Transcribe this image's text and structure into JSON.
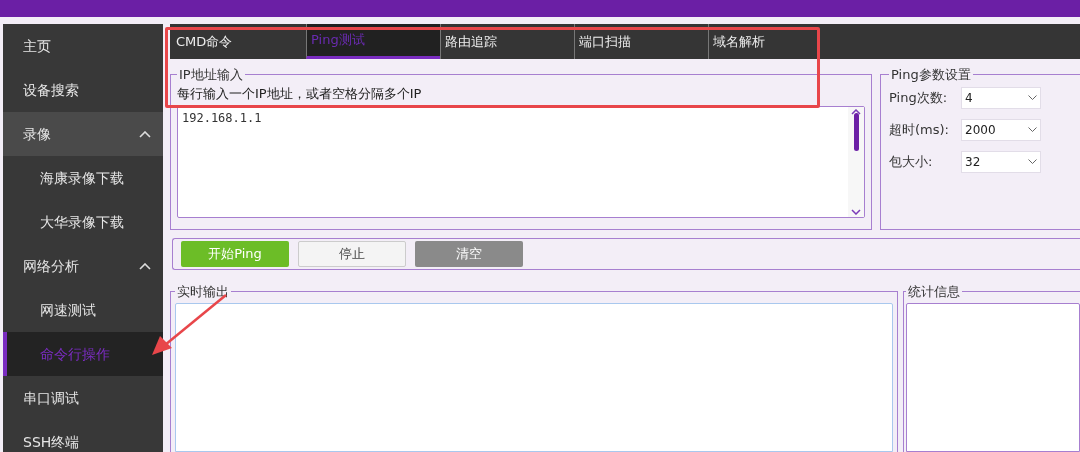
{
  "sidebar": {
    "items": [
      {
        "label": "主页",
        "selected": false,
        "hovered": false
      },
      {
        "label": "设备搜索",
        "selected": false,
        "hovered": false
      },
      {
        "label": "录像",
        "selected": false,
        "hovered": true,
        "expanded": true,
        "children": [
          {
            "label": "海康录像下载",
            "selected": false
          },
          {
            "label": "大华录像下载",
            "selected": false
          }
        ]
      },
      {
        "label": "网络分析",
        "selected": false,
        "hovered": false,
        "expanded": true,
        "children": [
          {
            "label": "网速测试",
            "selected": false
          },
          {
            "label": "命令行操作",
            "selected": true
          }
        ]
      },
      {
        "label": "串口调试",
        "selected": false,
        "hovered": false
      },
      {
        "label": "SSH终端",
        "selected": false,
        "hovered": false
      }
    ]
  },
  "tabs": [
    {
      "label": "CMD命令",
      "selected": false
    },
    {
      "label": "Ping测试",
      "selected": true
    },
    {
      "label": "路由追踪",
      "selected": false
    },
    {
      "label": "端口扫描",
      "selected": false
    },
    {
      "label": "域名解析",
      "selected": false
    }
  ],
  "ip_input": {
    "title": "IP地址输入",
    "hint": "每行输入一个IP地址，或者空格分隔多个IP",
    "value": "192.168.1.1"
  },
  "ping_settings": {
    "title": "Ping参数设置",
    "fields": [
      {
        "label": "Ping次数:",
        "value": "4"
      },
      {
        "label": "超时(ms):",
        "value": "2000"
      },
      {
        "label": "包大小:",
        "value": "32"
      }
    ]
  },
  "buttons": [
    {
      "label": "开始Ping",
      "kind": "primary"
    },
    {
      "label": "停止",
      "kind": "default"
    },
    {
      "label": "清空",
      "kind": "secondary"
    }
  ],
  "output_panels": [
    {
      "title": "实时输出"
    },
    {
      "title": "统计信息"
    }
  ]
}
